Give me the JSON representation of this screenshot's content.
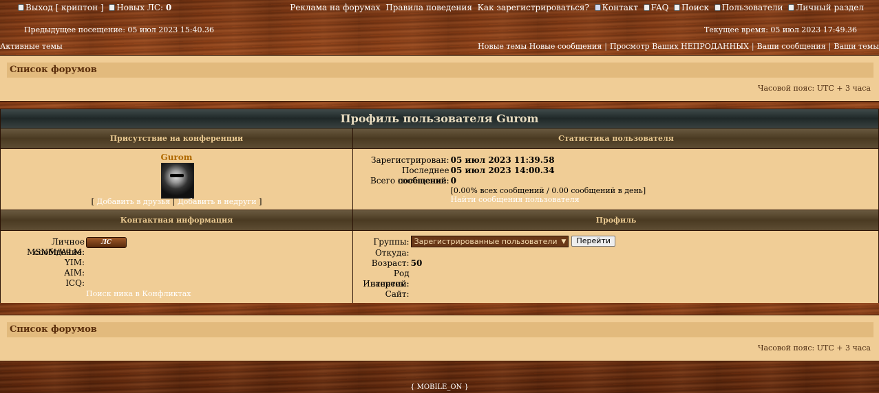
{
  "top": {
    "logout": "Выход [ криптон ]",
    "new_pm_label": "Новых ЛС:",
    "new_pm_count": "0",
    "ads": "Реклама на форумах",
    "rules": "Правила поведения",
    "register_how": "Как зарегистрироваться?",
    "contact": "Контакт",
    "faq": "FAQ",
    "search": "Поиск",
    "users": "Пользователи",
    "personal": "Личный раздел"
  },
  "visits": {
    "previous": "Предыдущее посещение: 05 июл 2023 15:40.36",
    "current": "Текущее время: 05 июл 2023 17:49.36"
  },
  "nav": {
    "active_topics": "Активные темы",
    "new_topics": "Новые темы",
    "new_posts": "Новые сообщения",
    "unsold": "Просмотр Ваших НЕПРОДАННЫХ",
    "your_posts": "Ваши сообщения",
    "your_topics": "Ваши темы"
  },
  "forum_list": "Список форумов",
  "timezone": "Часовой пояс: UTC + 3 часа",
  "profile": {
    "title": "Профиль пользователя Gurom",
    "presence_header": "Присутствие на конференции",
    "stats_header": "Статистика пользователя",
    "username": "Gurom",
    "add_friend": "Добавить в друзья",
    "add_foe": "Добавить в недруги",
    "registered_label": "Зарегистрирован:",
    "registered_value": "05 июл 2023 11:39.58",
    "last_visit_label": "Последнее посещение:",
    "last_visit_value": "05 июл 2023 14:00.34",
    "posts_label": "Всего сообщений:",
    "posts_value": "0",
    "posts_detail": "[0.00% всех сообщений / 0.00 сообщений в день]",
    "find_posts": "Найти сообщения пользователя",
    "contact_header": "Контактная информация",
    "profile_header": "Профиль",
    "pm_label": "Личное сообщение:",
    "pm_button": "ЛС",
    "msnm_label": "MSNM/WLM:",
    "yim_label": "YIM:",
    "aim_label": "AIM:",
    "icq_label": "ICQ:",
    "conflicts_search": "Поиск ника в Конфликтах",
    "groups_label": "Группы:",
    "groups_selected": "Зарегистрированные пользователи",
    "go_button": "Перейти",
    "from_label": "Откуда:",
    "age_label": "Возраст:",
    "age_value": "50",
    "occupation_label": "Род занятий:",
    "interests_label": "Интересы:",
    "site_label": "Сайт:"
  },
  "footer": "{ MOBILE_ON }"
}
